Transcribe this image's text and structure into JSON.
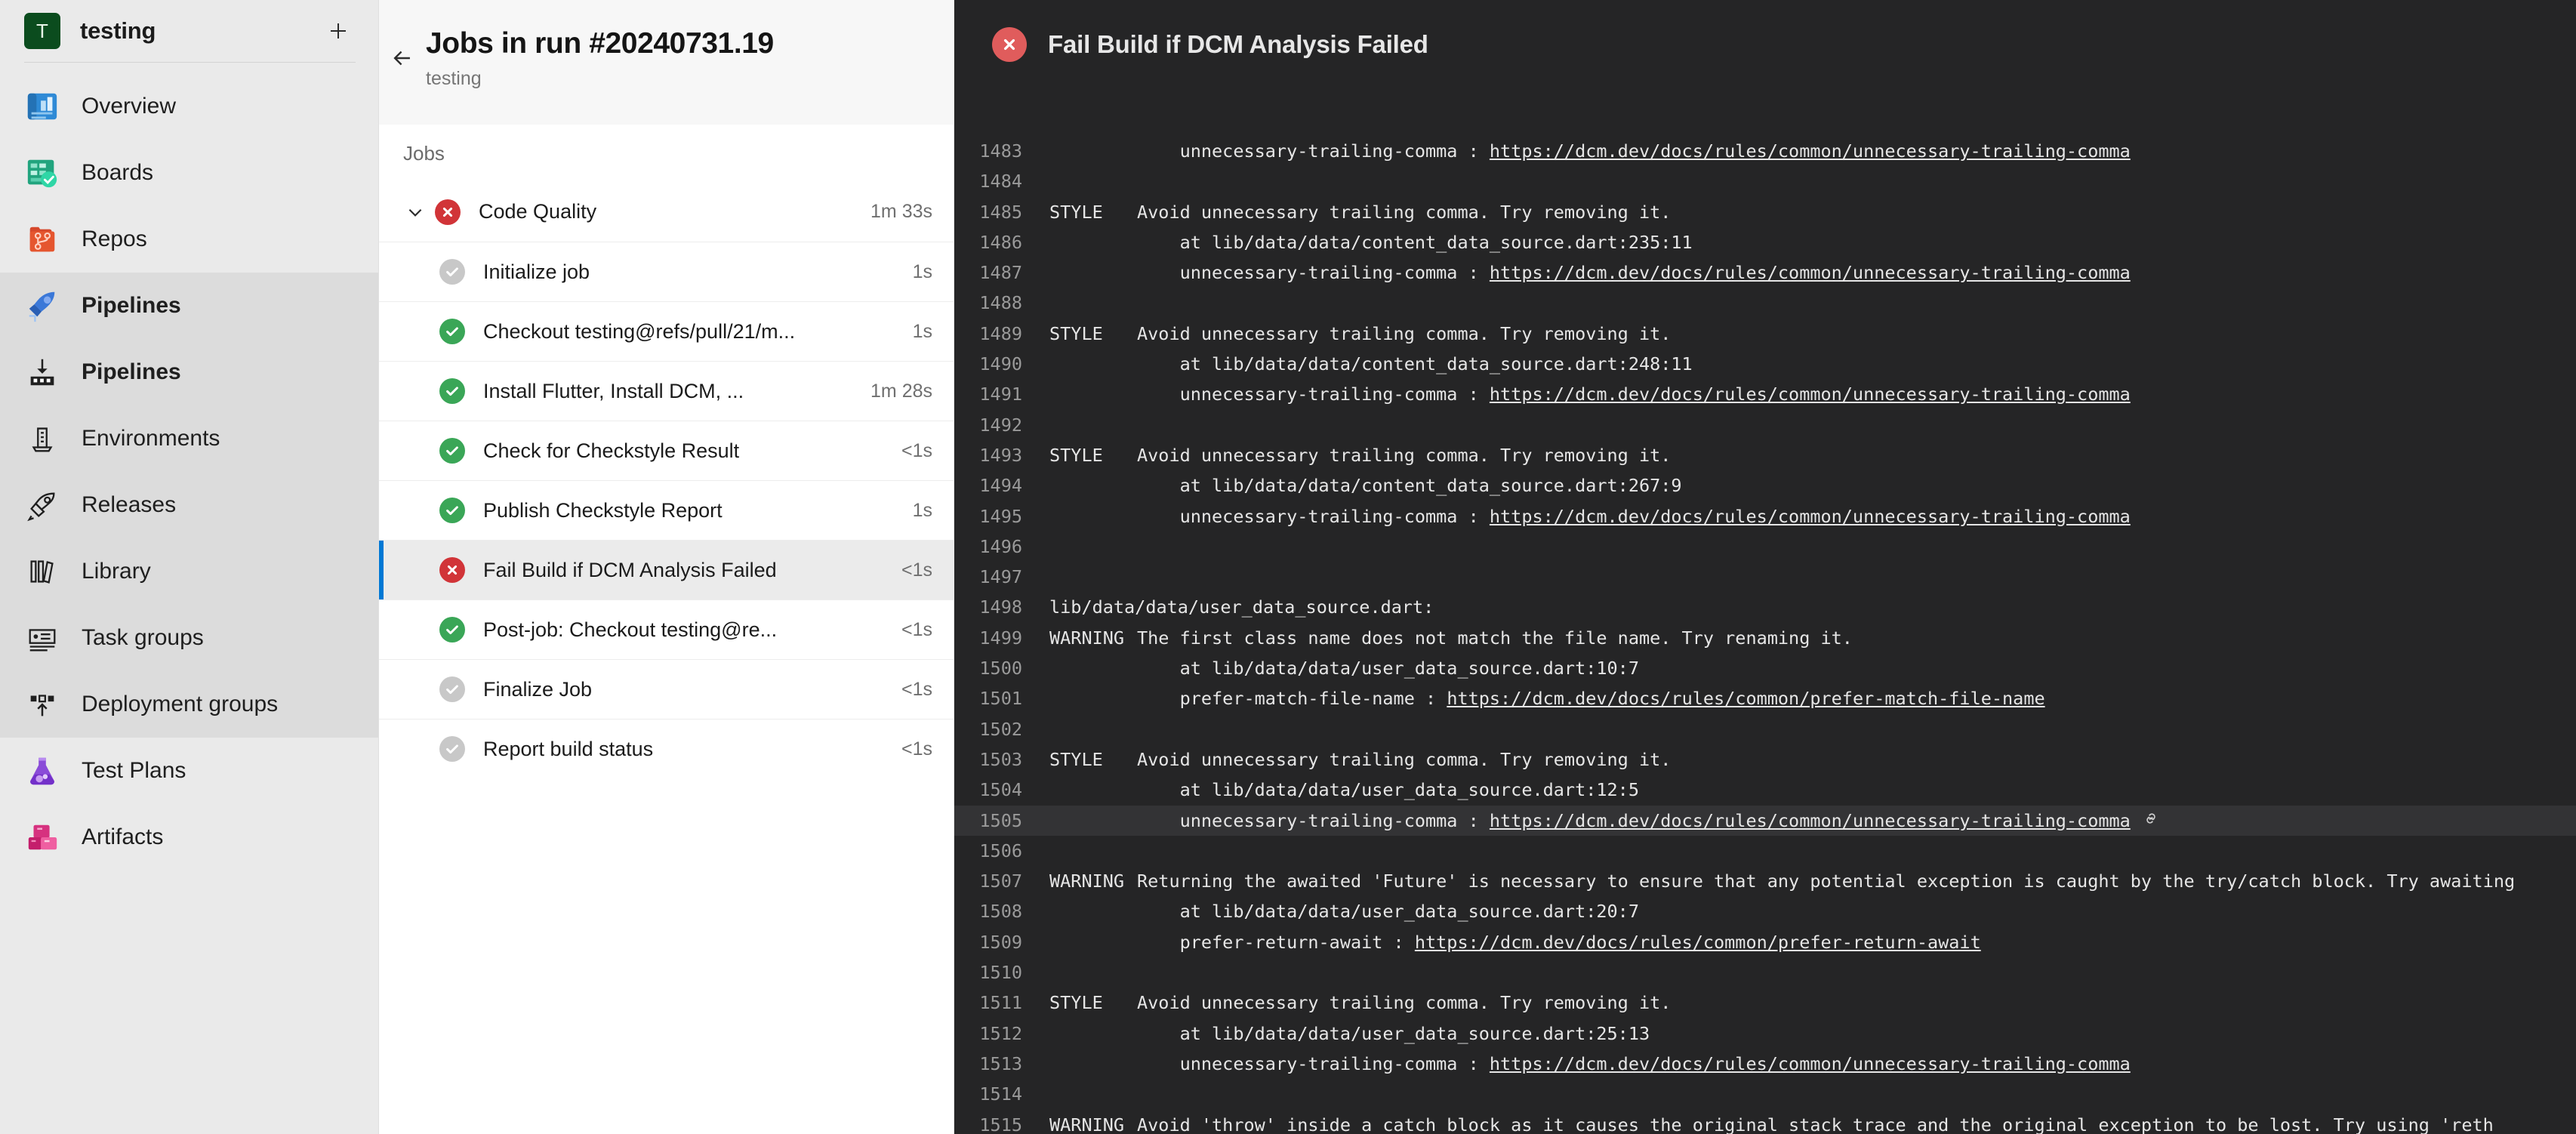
{
  "sidebar": {
    "project": {
      "initial": "T",
      "name": "testing",
      "add_label": "+",
      "avatar_color": "#0b4c1e"
    },
    "items": [
      {
        "label": "Overview",
        "icon": "overview-icon",
        "highlight": false,
        "bold": false
      },
      {
        "label": "Boards",
        "icon": "boards-icon",
        "highlight": false,
        "bold": false
      },
      {
        "label": "Repos",
        "icon": "repos-icon",
        "highlight": false,
        "bold": false
      },
      {
        "label": "Pipelines",
        "icon": "pipelines-rocket-icon",
        "highlight": true,
        "bold": true
      },
      {
        "label": "Pipelines",
        "icon": "pipelines-runs-icon",
        "highlight": true,
        "bold": true
      },
      {
        "label": "Environments",
        "icon": "environments-icon",
        "highlight": true,
        "bold": false
      },
      {
        "label": "Releases",
        "icon": "releases-icon",
        "highlight": true,
        "bold": false
      },
      {
        "label": "Library",
        "icon": "library-icon",
        "highlight": true,
        "bold": false
      },
      {
        "label": "Task groups",
        "icon": "task-groups-icon",
        "highlight": true,
        "bold": false
      },
      {
        "label": "Deployment groups",
        "icon": "deployment-groups-icon",
        "highlight": true,
        "bold": false
      },
      {
        "label": "Test Plans",
        "icon": "test-plans-icon",
        "highlight": false,
        "bold": false
      },
      {
        "label": "Artifacts",
        "icon": "artifacts-icon",
        "highlight": false,
        "bold": false
      }
    ]
  },
  "jobs_panel": {
    "back_label": "←",
    "title": "Jobs in run #20240731.19",
    "subtitle": "testing",
    "section_label": "Jobs",
    "rows": [
      {
        "name": "Code Quality",
        "duration": "1m 33s",
        "status": "fail",
        "level": "parent",
        "selected": false,
        "expanded": true
      },
      {
        "name": "Initialize job",
        "duration": "1s",
        "status": "skip",
        "level": "child",
        "selected": false
      },
      {
        "name": "Checkout testing@refs/pull/21/m...",
        "duration": "1s",
        "status": "pass",
        "level": "child",
        "selected": false
      },
      {
        "name": "Install Flutter, Install DCM, ...",
        "duration": "1m 28s",
        "status": "pass",
        "level": "child",
        "selected": false
      },
      {
        "name": "Check for Checkstyle Result",
        "duration": "<1s",
        "status": "pass",
        "level": "child",
        "selected": false
      },
      {
        "name": "Publish Checkstyle Report",
        "duration": "1s",
        "status": "pass",
        "level": "child",
        "selected": false
      },
      {
        "name": "Fail Build if DCM Analysis Failed",
        "duration": "<1s",
        "status": "fail",
        "level": "child",
        "selected": true
      },
      {
        "name": "Post-job: Checkout testing@re...",
        "duration": "<1s",
        "status": "pass",
        "level": "child",
        "selected": false
      },
      {
        "name": "Finalize Job",
        "duration": "<1s",
        "status": "skip",
        "level": "child",
        "selected": false
      },
      {
        "name": "Report build status",
        "duration": "<1s",
        "status": "skip",
        "level": "child",
        "selected": false
      }
    ]
  },
  "log": {
    "status": "fail",
    "title": "Fail Build if DCM Analysis Failed",
    "lines": [
      {
        "n": 1483,
        "sev": "",
        "msg": "    unnecessary-trailing-comma : ",
        "link": "https://dcm.dev/docs/rules/common/unnecessary-trailing-comma"
      },
      {
        "n": 1484,
        "sev": "",
        "msg": ""
      },
      {
        "n": 1485,
        "sev": "STYLE",
        "msg": "Avoid unnecessary trailing comma. Try removing it."
      },
      {
        "n": 1486,
        "sev": "",
        "msg": "    at lib/data/data/content_data_source.dart:235:11"
      },
      {
        "n": 1487,
        "sev": "",
        "msg": "    unnecessary-trailing-comma : ",
        "link": "https://dcm.dev/docs/rules/common/unnecessary-trailing-comma"
      },
      {
        "n": 1488,
        "sev": "",
        "msg": ""
      },
      {
        "n": 1489,
        "sev": "STYLE",
        "msg": "Avoid unnecessary trailing comma. Try removing it."
      },
      {
        "n": 1490,
        "sev": "",
        "msg": "    at lib/data/data/content_data_source.dart:248:11"
      },
      {
        "n": 1491,
        "sev": "",
        "msg": "    unnecessary-trailing-comma : ",
        "link": "https://dcm.dev/docs/rules/common/unnecessary-trailing-comma"
      },
      {
        "n": 1492,
        "sev": "",
        "msg": ""
      },
      {
        "n": 1493,
        "sev": "STYLE",
        "msg": "Avoid unnecessary trailing comma. Try removing it."
      },
      {
        "n": 1494,
        "sev": "",
        "msg": "    at lib/data/data/content_data_source.dart:267:9"
      },
      {
        "n": 1495,
        "sev": "",
        "msg": "    unnecessary-trailing-comma : ",
        "link": "https://dcm.dev/docs/rules/common/unnecessary-trailing-comma"
      },
      {
        "n": 1496,
        "sev": "",
        "msg": ""
      },
      {
        "n": 1497,
        "sev": "",
        "msg": ""
      },
      {
        "n": 1498,
        "sev": "",
        "msg": "lib/data/data/user_data_source.dart:",
        "nosev": true
      },
      {
        "n": 1499,
        "sev": "WARNING",
        "msg": "The first class name does not match the file name. Try renaming it."
      },
      {
        "n": 1500,
        "sev": "",
        "msg": "    at lib/data/data/user_data_source.dart:10:7"
      },
      {
        "n": 1501,
        "sev": "",
        "msg": "    prefer-match-file-name : ",
        "link": "https://dcm.dev/docs/rules/common/prefer-match-file-name"
      },
      {
        "n": 1502,
        "sev": "",
        "msg": ""
      },
      {
        "n": 1503,
        "sev": "STYLE",
        "msg": "Avoid unnecessary trailing comma. Try removing it."
      },
      {
        "n": 1504,
        "sev": "",
        "msg": "    at lib/data/data/user_data_source.dart:12:5"
      },
      {
        "n": 1505,
        "sev": "",
        "msg": "    unnecessary-trailing-comma : ",
        "link": "https://dcm.dev/docs/rules/common/unnecessary-trailing-comma",
        "highlight": true,
        "permalink_icon": "link-icon"
      },
      {
        "n": 1506,
        "sev": "",
        "msg": ""
      },
      {
        "n": 1507,
        "sev": "WARNING",
        "msg": "Returning the awaited 'Future' is necessary to ensure that any potential exception is caught by the try/catch block. Try awaiting"
      },
      {
        "n": 1508,
        "sev": "",
        "msg": "    at lib/data/data/user_data_source.dart:20:7"
      },
      {
        "n": 1509,
        "sev": "",
        "msg": "    prefer-return-await : ",
        "link": "https://dcm.dev/docs/rules/common/prefer-return-await"
      },
      {
        "n": 1510,
        "sev": "",
        "msg": ""
      },
      {
        "n": 1511,
        "sev": "STYLE",
        "msg": "Avoid unnecessary trailing comma. Try removing it."
      },
      {
        "n": 1512,
        "sev": "",
        "msg": "    at lib/data/data/user_data_source.dart:25:13"
      },
      {
        "n": 1513,
        "sev": "",
        "msg": "    unnecessary-trailing-comma : ",
        "link": "https://dcm.dev/docs/rules/common/unnecessary-trailing-comma"
      },
      {
        "n": 1514,
        "sev": "",
        "msg": ""
      },
      {
        "n": 1515,
        "sev": "WARNING",
        "msg": "Avoid 'throw' inside a catch block as it causes the original stack trace and the original exception to be lost. Try using 'reth"
      }
    ]
  },
  "colors": {
    "accent": "#0078d4",
    "fail": "#d13438",
    "pass": "#3aa657",
    "skip": "#c8c8c8",
    "log_bg": "#252526"
  }
}
